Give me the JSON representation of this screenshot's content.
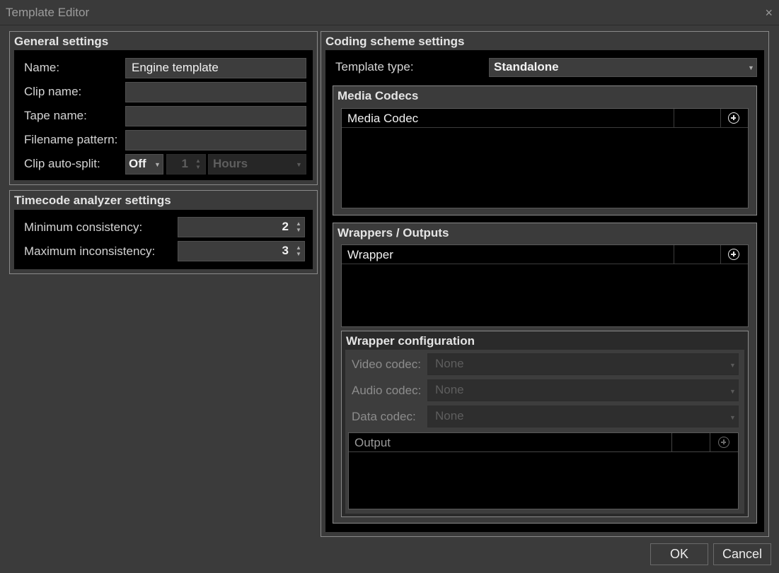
{
  "window": {
    "title": "Template Editor",
    "close_glyph": "×"
  },
  "general": {
    "title": "General settings",
    "name_label": "Name:",
    "name_value": "Engine template",
    "clip_name_label": "Clip name:",
    "clip_name_value": "",
    "tape_name_label": "Tape name:",
    "tape_name_value": "",
    "filename_label": "Filename pattern:",
    "filename_value": "",
    "autosplit_label": "Clip auto-split:",
    "autosplit_mode": "Off",
    "autosplit_count": "1",
    "autosplit_unit": "Hours"
  },
  "timecode": {
    "title": "Timecode analyzer settings",
    "min_label": "Minimum consistency:",
    "min_value": "2",
    "max_label": "Maximum inconsistency:",
    "max_value": "3"
  },
  "coding": {
    "title": "Coding scheme settings",
    "template_type_label": "Template type:",
    "template_type_value": "Standalone",
    "media_codecs": {
      "title": "Media Codecs",
      "column": "Media Codec"
    },
    "wrappers": {
      "title": "Wrappers / Outputs",
      "column": "Wrapper"
    },
    "wrapper_config": {
      "title": "Wrapper configuration",
      "video_label": "Video codec:",
      "video_value": "None",
      "audio_label": "Audio codec:",
      "audio_value": "None",
      "data_label": "Data codec:",
      "data_value": "None",
      "output_column": "Output"
    }
  },
  "buttons": {
    "ok": "OK",
    "cancel": "Cancel"
  },
  "icons": {
    "add": "add-circle-icon",
    "dropdown": "chevron-down-icon",
    "spin": "spin-arrows-icon",
    "close": "close-icon"
  }
}
